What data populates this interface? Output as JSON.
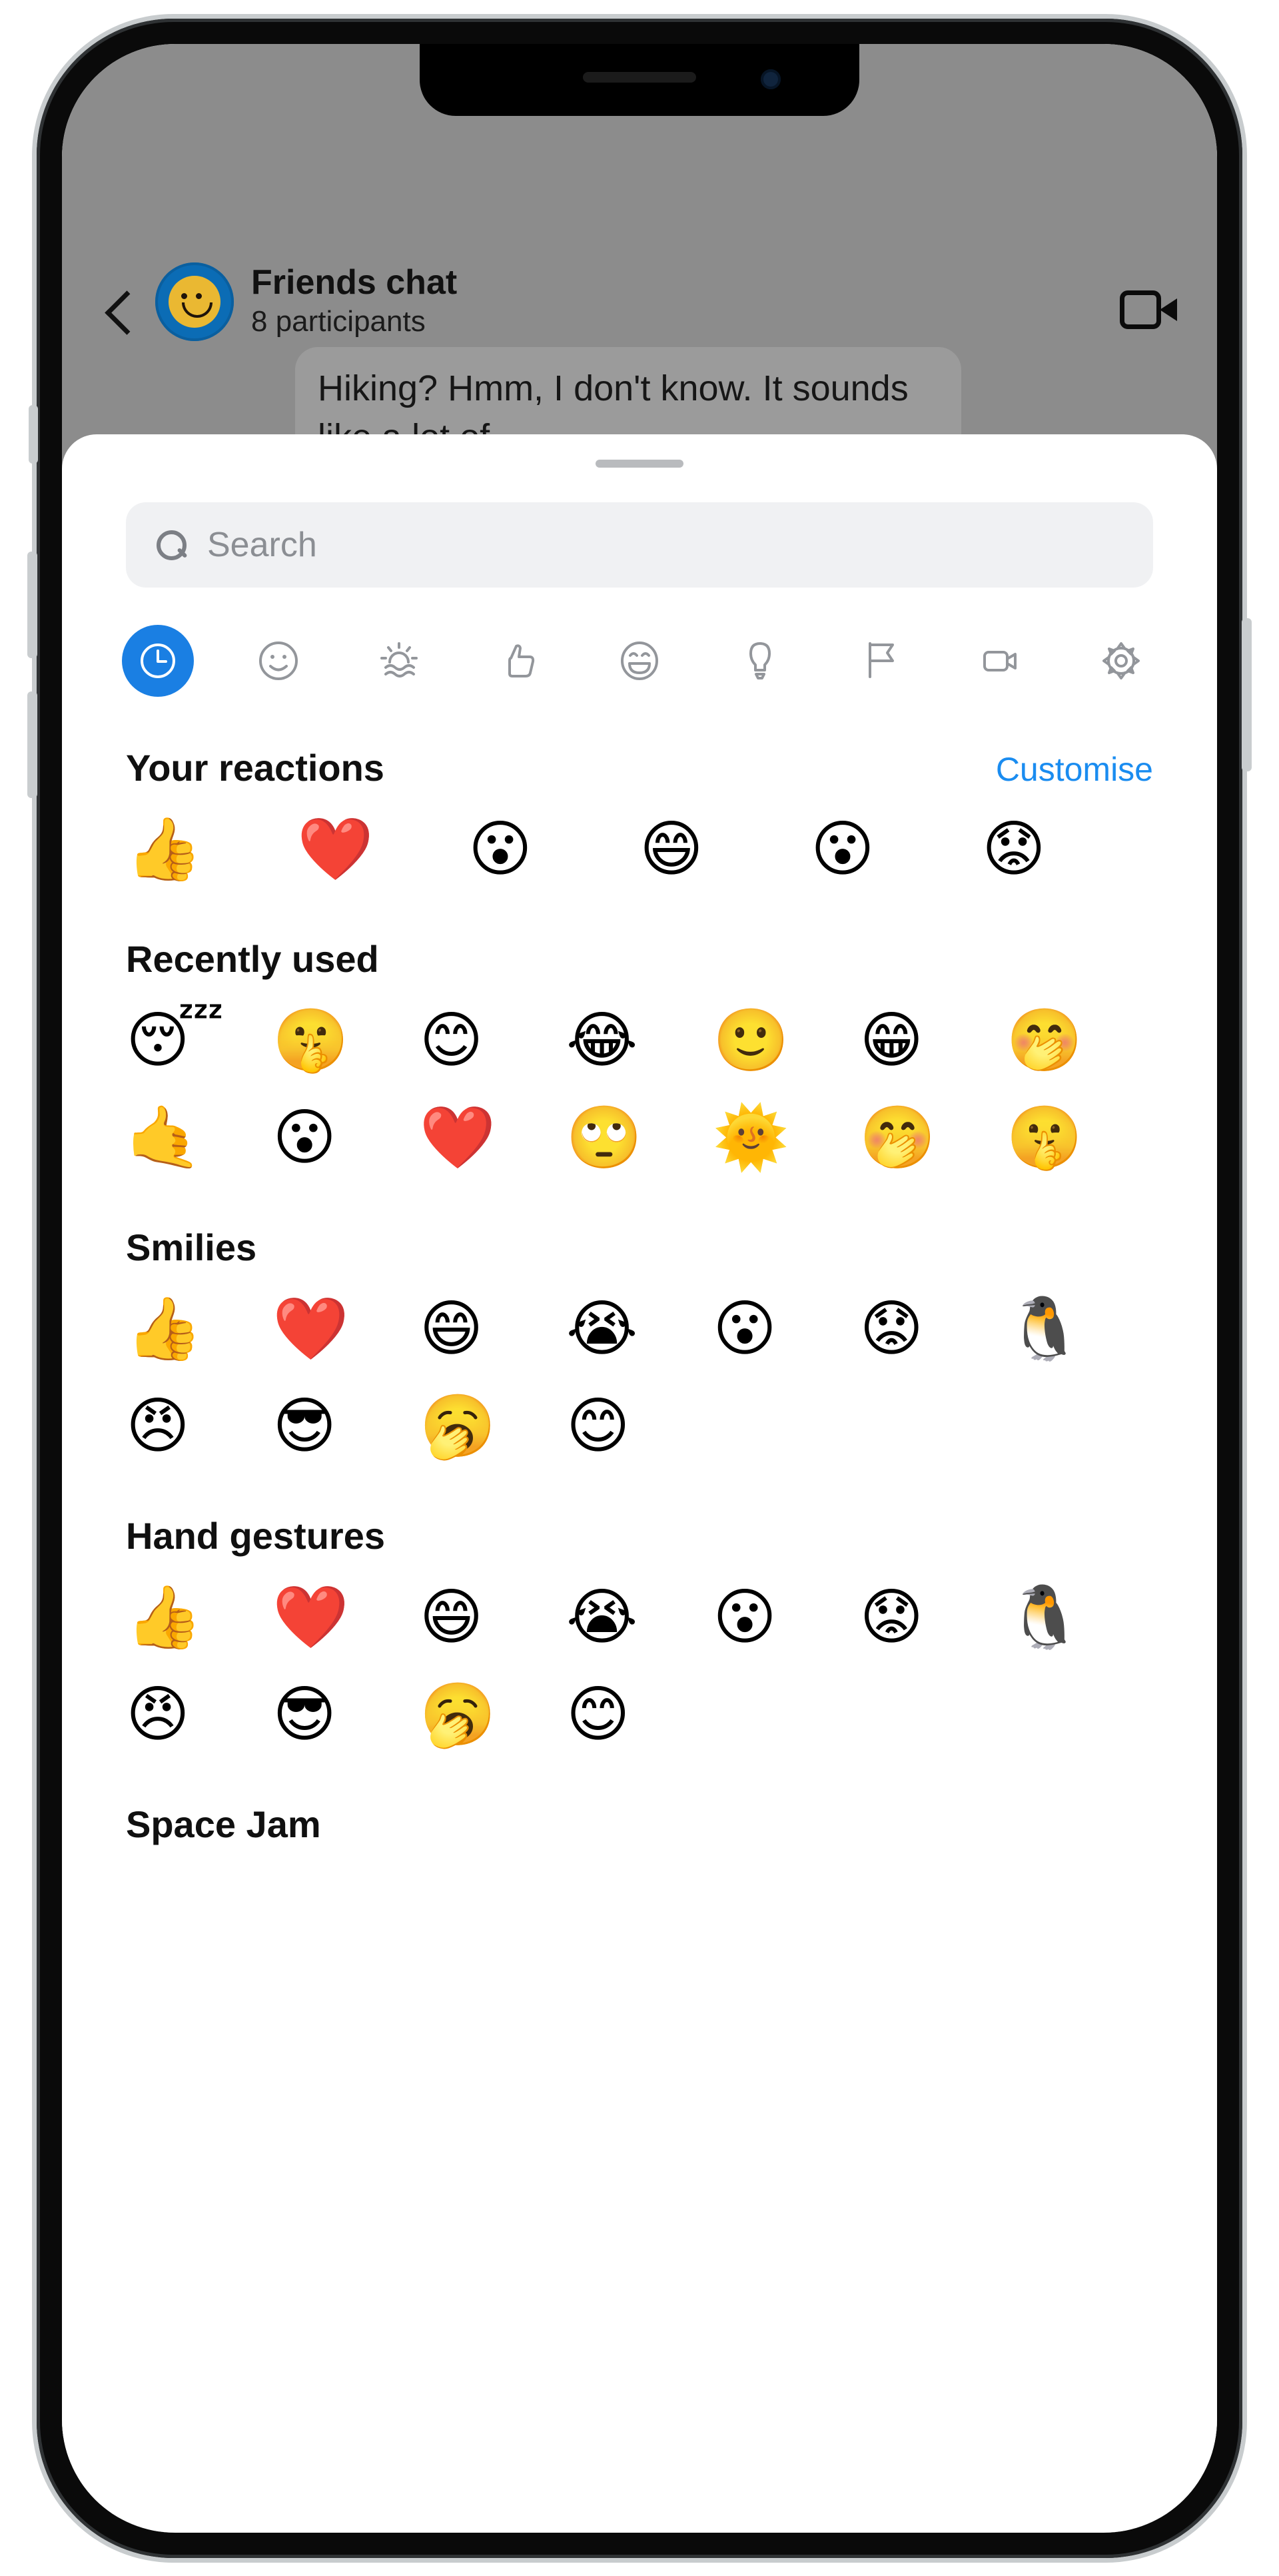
{
  "chat": {
    "title": "Friends chat",
    "subtitle": "8 participants",
    "back_icon": "chevron-left-icon",
    "avatar_icon": "smiley-avatar",
    "video_icon": "video-camera-icon",
    "visible_message": "Hiking? Hmm, I don't know. It sounds like a lot of"
  },
  "sheet": {
    "grabber": "drag-handle",
    "search": {
      "placeholder": "Search",
      "value": "",
      "icon": "search-icon"
    },
    "categories": [
      {
        "name": "recent",
        "icon": "clock-icon",
        "active": true
      },
      {
        "name": "smileys",
        "icon": "smiley-icon",
        "active": false
      },
      {
        "name": "nature",
        "icon": "sunset-waves-icon",
        "active": false
      },
      {
        "name": "gestures",
        "icon": "thumbs-up-icon",
        "active": false
      },
      {
        "name": "expressions",
        "icon": "grin-icon",
        "active": false
      },
      {
        "name": "objects",
        "icon": "lightbulb-icon",
        "active": false
      },
      {
        "name": "flags",
        "icon": "flag-icon",
        "active": false
      },
      {
        "name": "video",
        "icon": "video-camera-icon",
        "active": false
      },
      {
        "name": "settings",
        "icon": "gear-icon",
        "active": false
      }
    ],
    "sections": [
      {
        "title": "Your reactions",
        "action": "Customise",
        "columns": 6,
        "emojis": [
          "👍",
          "❤️",
          "😮",
          "😄",
          "😮",
          "😟"
        ],
        "emoji_names": [
          "thumbs-up",
          "red-heart",
          "open-mouth",
          "grinning-smiling-eyes",
          "open-mouth",
          "worried-face"
        ]
      },
      {
        "title": "Recently used",
        "action": "",
        "columns": 7,
        "emojis": [
          "😴",
          "🤫",
          "😊",
          "😂",
          "🙂",
          "😁",
          "🤭",
          "🤙",
          "😮",
          "❤️",
          "🙄",
          "🌞",
          "🤭",
          "🤫"
        ],
        "emoji_names": [
          "sleeping-face",
          "shushing-face",
          "smiling-face",
          "tears-of-joy",
          "slight-smile",
          "beaming-face",
          "hand-over-mouth",
          "call-me-hand",
          "open-mouth",
          "red-heart",
          "rolling-eyes",
          "sun-with-face",
          "hand-over-mouth",
          "shushing-face"
        ]
      },
      {
        "title": "Smilies",
        "action": "",
        "columns": 7,
        "emojis": [
          "👍",
          "❤️",
          "😄",
          "😭",
          "😮",
          "😟",
          "🐧",
          "😠",
          "😎",
          "🥱",
          "😊"
        ],
        "emoji_names": [
          "thumbs-up",
          "red-heart",
          "grinning-smiling-eyes",
          "loudly-crying",
          "open-mouth",
          "worried-face",
          "penguin",
          "angry-face",
          "sunglasses-face",
          "yawning-face",
          "smiling-face"
        ]
      },
      {
        "title": "Hand gestures",
        "action": "",
        "columns": 7,
        "emojis": [
          "👍",
          "❤️",
          "😄",
          "😭",
          "😮",
          "😟",
          "🐧",
          "😠",
          "😎",
          "🥱",
          "😊"
        ],
        "emoji_names": [
          "thumbs-up",
          "red-heart",
          "grinning-smiling-eyes",
          "loudly-crying",
          "open-mouth",
          "worried-face",
          "penguin",
          "angry-face",
          "sunglasses-face",
          "yawning-face",
          "smiling-face"
        ]
      },
      {
        "title": "Space Jam",
        "action": "",
        "columns": 7,
        "emojis": [],
        "emoji_names": []
      }
    ]
  },
  "colors": {
    "accent": "#1a8cf0",
    "active_tab": "#1a7fe3",
    "sheet_bg": "#ffffff",
    "search_bg": "#f0f1f3",
    "backdrop": "#8c8c8c"
  }
}
